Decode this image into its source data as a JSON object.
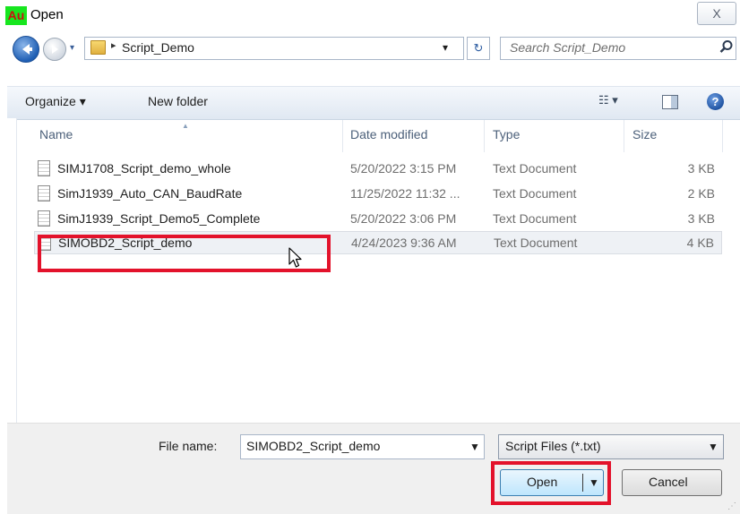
{
  "window": {
    "title": "Open",
    "app_icon_text": "Au",
    "close_symbol": "X"
  },
  "address": {
    "crumb_separator": "▸",
    "current_folder": "Script_Demo",
    "dropdown_glyph": "▾",
    "refresh_glyph": "↻"
  },
  "search": {
    "placeholder": "Search Script_Demo",
    "icon": "search-icon"
  },
  "toolbar": {
    "organize_label": "Organize ▾",
    "new_folder_label": "New folder",
    "views_glyph": "☷ ▾",
    "help_glyph": "?"
  },
  "columns": {
    "name": "Name",
    "date": "Date modified",
    "type": "Type",
    "size": "Size"
  },
  "files": [
    {
      "name": "SIMJ1708_Script_demo_whole",
      "date": "5/20/2022 3:15 PM",
      "type": "Text Document",
      "size": "3 KB"
    },
    {
      "name": "SimJ1939_Auto_CAN_BaudRate",
      "date": "11/25/2022 11:32 ...",
      "type": "Text Document",
      "size": "2 KB"
    },
    {
      "name": "SimJ1939_Script_Demo5_Complete",
      "date": "5/20/2022 3:06 PM",
      "type": "Text Document",
      "size": "3 KB"
    },
    {
      "name": "SIMOBD2_Script_demo",
      "date": "4/24/2023 9:36 AM",
      "type": "Text Document",
      "size": "4 KB"
    }
  ],
  "bottom": {
    "file_name_label": "File name:",
    "file_name_value": "SIMOBD2_Script_demo",
    "filter_value": "Script Files (*.txt)",
    "open_label": "Open",
    "cancel_label": "Cancel",
    "drop_glyph": "▼"
  },
  "colors": {
    "highlight": "#e3122b",
    "selected_row": "#eef1f5",
    "toolbar": "#e0e8f2"
  }
}
